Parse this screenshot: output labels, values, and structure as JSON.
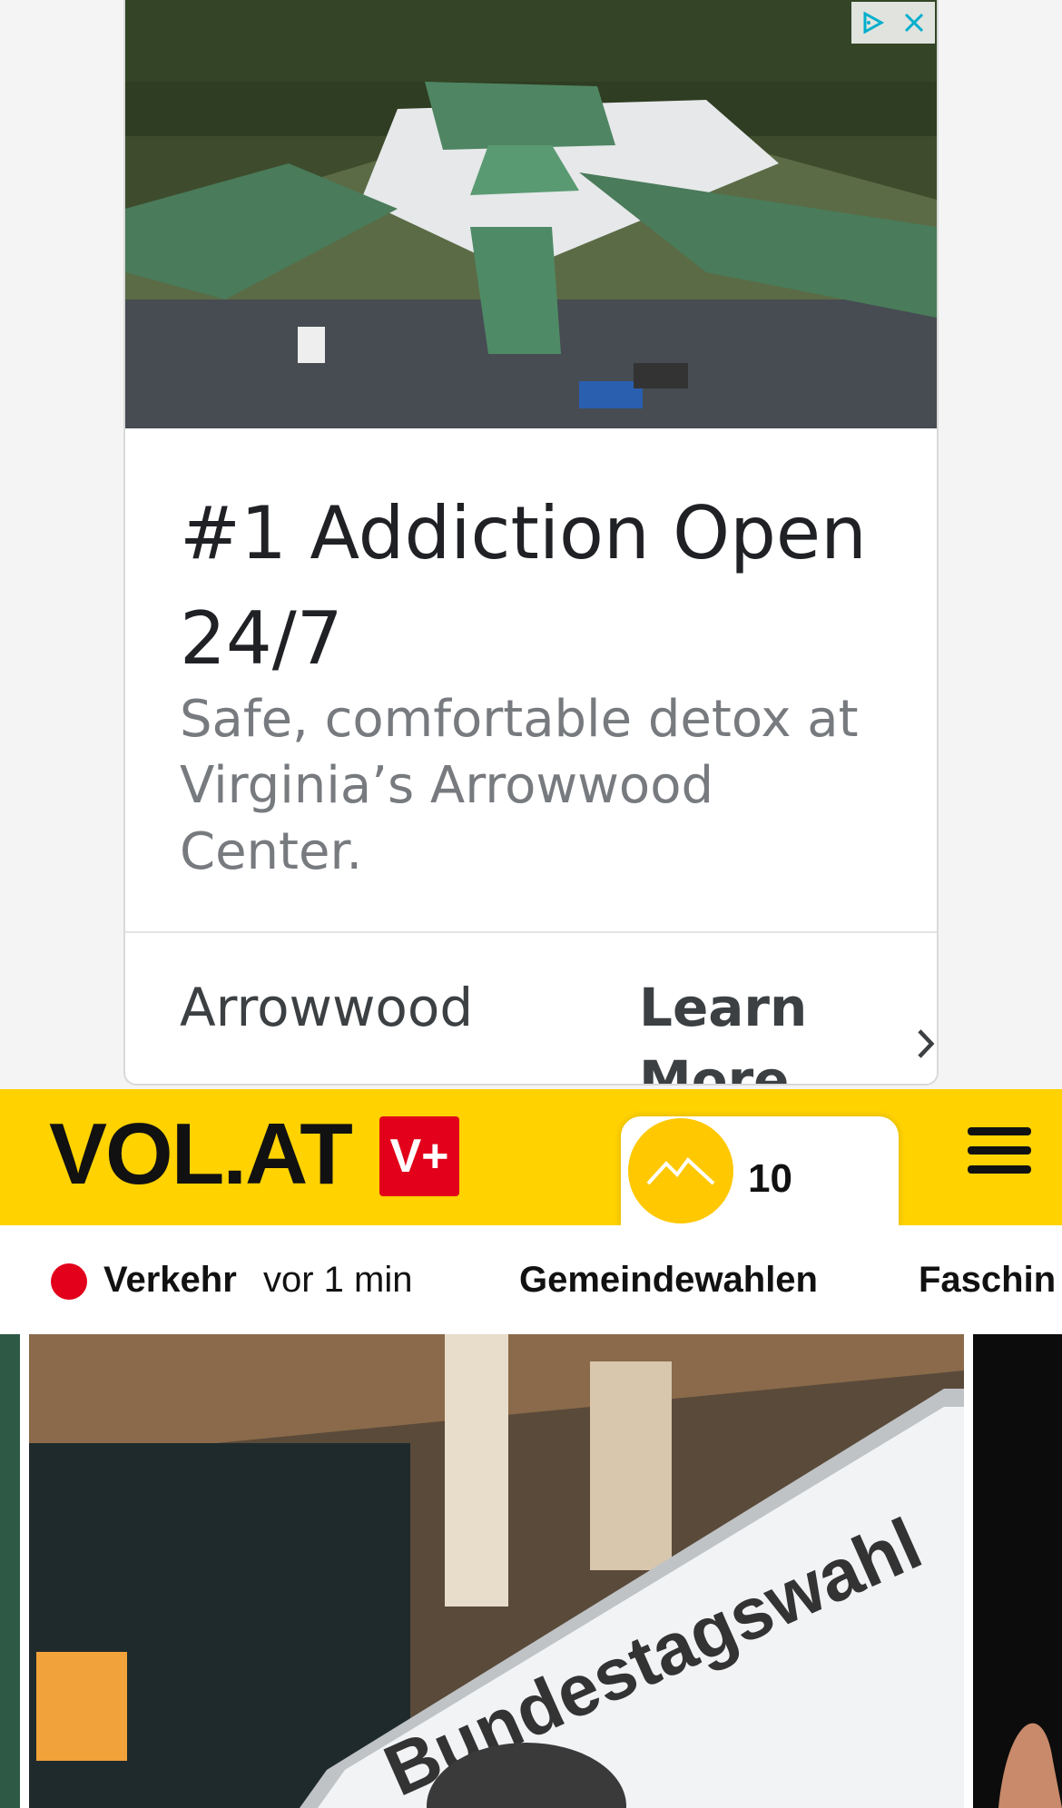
{
  "ad": {
    "title": "#1 Addiction Open 24/7",
    "description": "Safe, comfortable detox at Virginia’s Arrowwood Center.",
    "advertiser": "Arrowwood",
    "cta_label": "Learn More",
    "image_alt": "aerial-view-of-treatment-center"
  },
  "header": {
    "logo": "VOL.AT",
    "plus_badge": "V+",
    "weather_temp": "10",
    "weather_icon": "sun-mountain-icon"
  },
  "ticker": {
    "items": [
      {
        "label": "Verkehr",
        "time": "vor 1 min"
      },
      {
        "label": "Gemeindewahlen"
      },
      {
        "label": "Faschin"
      }
    ]
  },
  "hero": {
    "sign_text": "Bundestagswahl"
  },
  "colors": {
    "brand_yellow": "#ffd200",
    "brand_red": "#e2001a",
    "ad_text": "#202124",
    "ad_muted": "#777a7e"
  }
}
